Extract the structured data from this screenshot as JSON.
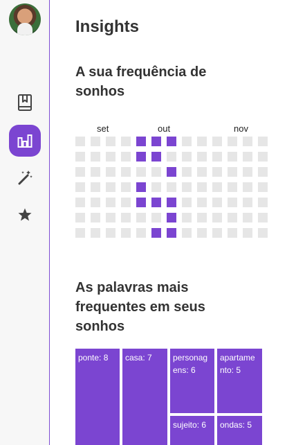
{
  "page": {
    "title": "Insights"
  },
  "nav": {
    "items": [
      {
        "name": "journal",
        "icon": "bookmark-book-icon",
        "active": false
      },
      {
        "name": "insights",
        "icon": "bar-chart-icon",
        "active": true
      },
      {
        "name": "magic",
        "icon": "magic-wand-icon",
        "active": false
      },
      {
        "name": "favorites",
        "icon": "star-icon",
        "active": false
      }
    ]
  },
  "frequency": {
    "title": "A sua frequência de sonhos",
    "months": [
      "set",
      "out",
      "nov"
    ],
    "grid": [
      [
        0,
        0,
        0,
        0,
        1,
        1,
        1,
        0,
        0,
        0,
        0,
        0,
        0
      ],
      [
        0,
        0,
        0,
        0,
        1,
        1,
        0,
        0,
        0,
        0,
        0,
        0,
        0
      ],
      [
        0,
        0,
        0,
        0,
        0,
        0,
        1,
        0,
        0,
        0,
        0,
        0,
        0
      ],
      [
        0,
        0,
        0,
        0,
        1,
        0,
        0,
        0,
        0,
        0,
        0,
        0,
        0
      ],
      [
        0,
        0,
        0,
        0,
        1,
        1,
        1,
        0,
        0,
        0,
        0,
        0,
        0
      ],
      [
        0,
        0,
        0,
        0,
        0,
        0,
        1,
        0,
        0,
        0,
        0,
        0,
        0
      ],
      [
        0,
        0,
        0,
        0,
        0,
        1,
        1,
        0,
        0,
        0,
        0,
        0,
        0
      ]
    ],
    "colors": {
      "active": "#7b45d1",
      "inactive": "#e6e6e6"
    }
  },
  "words": {
    "title": "As palavras mais frequentes em seus sonhos",
    "items": [
      {
        "label": "ponte: 8",
        "word": "ponte",
        "count": 8
      },
      {
        "label": "casa: 7",
        "word": "casa",
        "count": 7
      },
      {
        "label": "personagens: 6",
        "word": "personagens",
        "count": 6
      },
      {
        "label": "apartamento: 5",
        "word": "apartamento",
        "count": 5
      },
      {
        "label": "sujeito: 6",
        "word": "sujeito",
        "count": 6
      },
      {
        "label": "ondas: 5",
        "word": "ondas",
        "count": 5
      }
    ]
  },
  "theme": {
    "accent": "#7b45d1"
  }
}
